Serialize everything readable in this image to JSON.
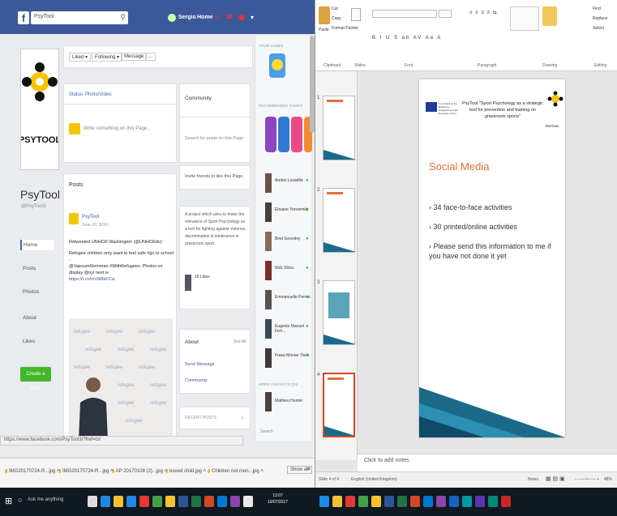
{
  "facebook": {
    "search_value": "PsyTool",
    "top_links": [
      "Sergio",
      "Home"
    ],
    "like_label": "Liked ▾",
    "following_label": "Following ▾",
    "message_label": "Message",
    "more_label": "...",
    "page_name": "PsyTool",
    "page_handle": "@PsyTool3",
    "nav": [
      "Home",
      "Posts",
      "Photos",
      "About",
      "Likes"
    ],
    "create_page": "Create a Page",
    "status_tab": "Status",
    "photo_tab": "Photo/Video",
    "composer_placeholder": "Write something on this Page...",
    "posts_heading": "Posts",
    "post_author": "PsyTool",
    "post_date": "June 20, 2016 ·",
    "post_text_1": "Retweeted UNHCR Washington (@UNHCRdc):",
    "post_text_2": "Refugee children only want to feel safe #go to school -",
    "post_text_3": "@VapsumKlemman #WithRefugees. Photos on display @nyi next w",
    "post_link": "https://t.co/mV8l8kFCw",
    "community_heading": "Community",
    "community_search": "Search for posts on this Page",
    "invite": "Invite friends to like this Page",
    "project_text": "A project which aims to foster the relevance of Sport Psychology as a tool for fighting against violence, discrimination & intolerance in grassroots sport.",
    "likes_label": "15 Likes",
    "about_heading": "About",
    "see_all": "See All",
    "send_message": "Send Message",
    "community_link": "Community",
    "recent_posts": "RECENT POSTS",
    "your_games": "YOUR GAMES",
    "recommended_games": "RECOMMENDED GAMES",
    "contacts": [
      "Andrei Lovadtie",
      "Ehsane Yennemitz",
      "Bind Gooodvy",
      "Nick Silcia",
      "Emmanuelle Perrist",
      "Eugenio Manuel Fert...",
      "Frasa Moniar Tisch"
    ],
    "more_contacts": "MORE CONTACTS (33)",
    "last_contact": "Mathieu Hunter",
    "chat_search": "Search",
    "status_url": "https://www.facebook.com/PsyTool3/?fref=tsl"
  },
  "downloads": {
    "items": [
      "IMG20170724-R...jpg",
      "IMG20170724-R...jpg",
      "AP 20170108 (2)...jpg",
      "boxed child.jpg",
      "Children not mon...jpg"
    ],
    "show_all": "Show all"
  },
  "ppt": {
    "clipboard_cut": "Cut",
    "clipboard_copy": "Copy",
    "clipboard_format": "Format Painter",
    "paste": "Paste",
    "groups": [
      "Clipboard",
      "Slides",
      "Font",
      "Paragraph",
      "Drawing",
      "Editing"
    ],
    "find": "Find",
    "replace": "Replace",
    "select": "Select",
    "thumb_numbers": [
      "1",
      "2",
      "3",
      "4"
    ],
    "header_text": "PsyTool \"Sport Psychology as a strategic tool for prevention and training on grassroots sports\"",
    "eu_text": "Co-funded by the Erasmus+ Programme of the European Union",
    "logo_text": "PSYTOOL",
    "title": "Social Media",
    "bullets": [
      "34 face-to-face activities",
      "30 printed/online activities",
      "Please send this information to me if you have not done it yet"
    ],
    "notes": "Click to add notes",
    "status_left": "Slide 4 of 4",
    "status_lang": "English (United Kingdom)",
    "status_notes": "Notes",
    "status_zoom": "48%"
  },
  "taskbar": {
    "search": "Ask me anything",
    "time": "13:07",
    "date": "19/07/2017"
  }
}
